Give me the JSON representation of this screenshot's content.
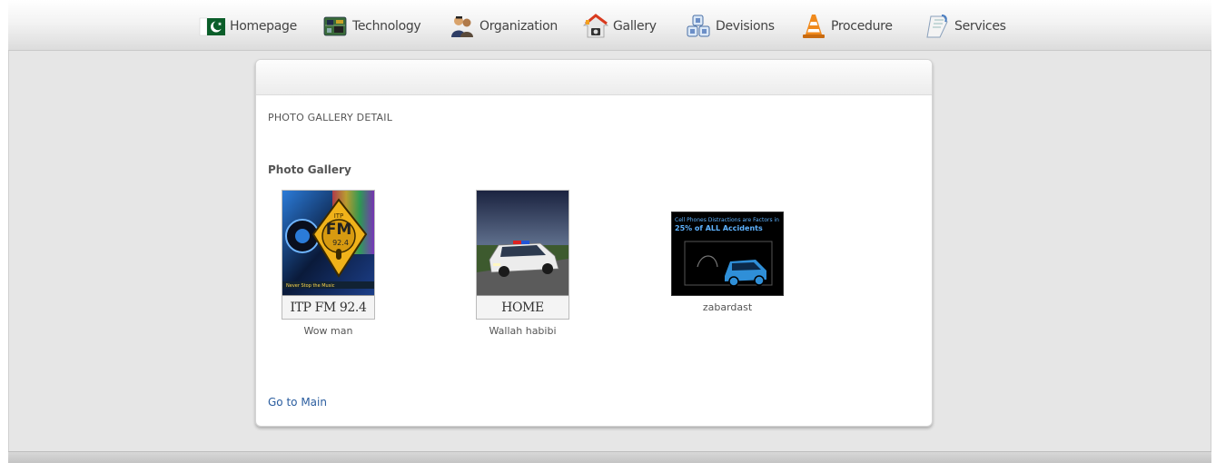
{
  "nav": {
    "items": [
      {
        "label": "Homepage",
        "icon": "pakistan-flag-icon"
      },
      {
        "label": "Technology",
        "icon": "circuit-board-icon"
      },
      {
        "label": "Organization",
        "icon": "people-icon"
      },
      {
        "label": "Gallery",
        "icon": "camera-house-icon"
      },
      {
        "label": "Devisions",
        "icon": "blocks-icon"
      },
      {
        "label": "Procedure",
        "icon": "traffic-cone-icon"
      },
      {
        "label": "Services",
        "icon": "document-icon"
      }
    ]
  },
  "panel": {
    "title": "PHOTO GALLERY DETAIL",
    "gallery_heading": "Photo Gallery",
    "photos": [
      {
        "name": "Wow man",
        "caption": "ITP FM 92.4",
        "logo_top": "ITP",
        "logo_fm": "FM",
        "logo_freq": "92.4",
        "tagline": "Never Stop the Music"
      },
      {
        "name": "Wallah habibi",
        "caption": "HOME"
      },
      {
        "name": "zabardast",
        "line1": "Cell Phones Distractions are Factors in",
        "line2": "25% of ALL Accidents"
      }
    ],
    "go_main": "Go to Main"
  },
  "colors": {
    "link": "#2a5d9f",
    "background": "#e6e6e6"
  }
}
